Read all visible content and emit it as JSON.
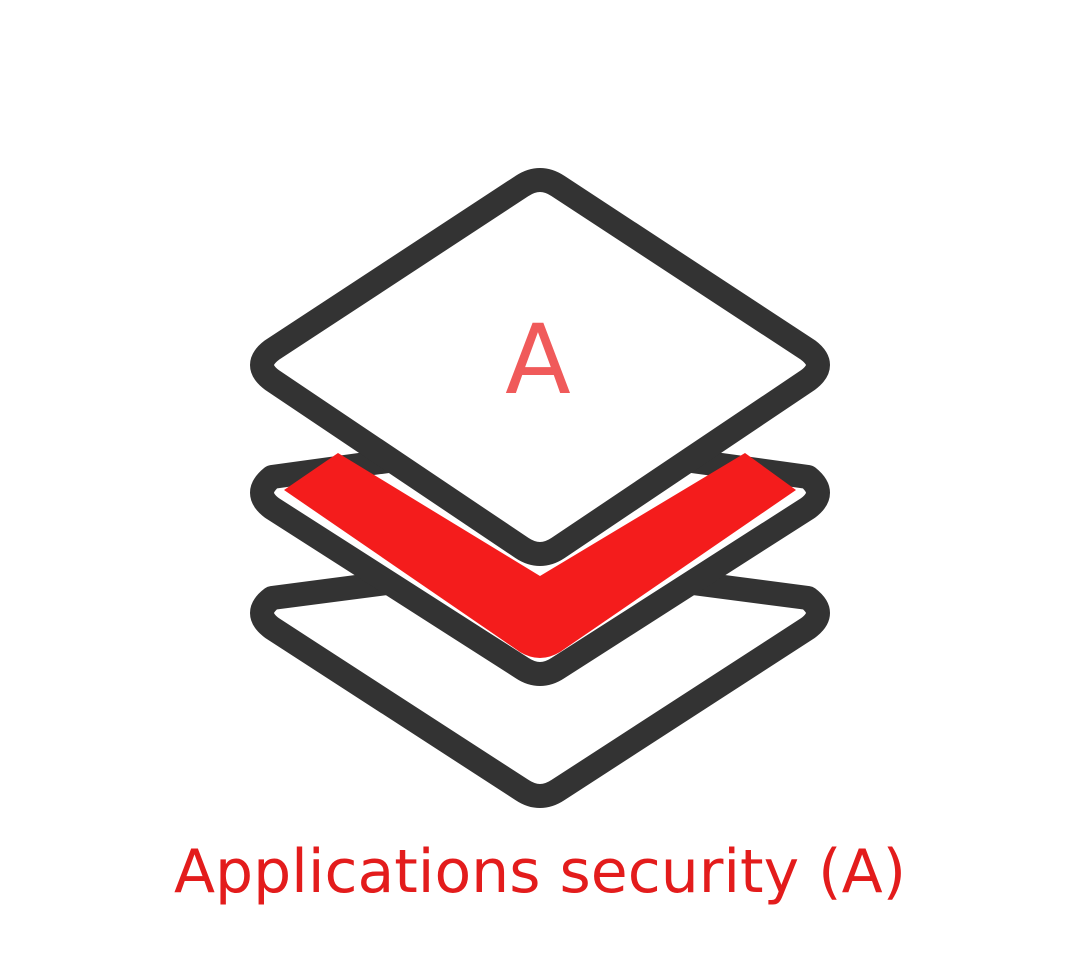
{
  "icon": {
    "name": "layers-icon",
    "top_layer_letter": "A",
    "letter_color": "#f05a5a",
    "outline_color": "#333333",
    "highlight_color": "#f41c1c"
  },
  "caption": {
    "text": "Applications security (A)",
    "color": "#e31c1c"
  }
}
